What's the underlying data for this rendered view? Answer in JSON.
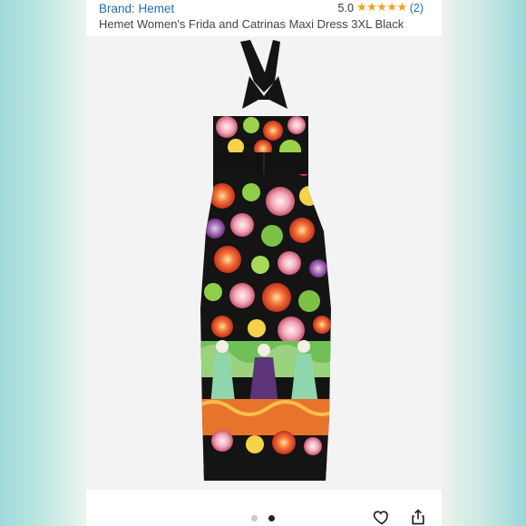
{
  "listing": {
    "brand_label": "Brand: Hemet",
    "rating_value": "5.0",
    "stars": "★★★★★",
    "review_count": "(2)",
    "title": "Hemet Women's Frida and Catrinas Maxi Dress 3XL Black"
  },
  "gallery": {
    "image_alt": "Black floral maxi dress with halter neck and Frida and Catrinas print",
    "pages": 2,
    "active_page": 2
  },
  "icons": {
    "favorite": "heart-outline-icon",
    "share": "share-icon"
  },
  "colors": {
    "link": "#1f6fb2",
    "star": "#f0a11b",
    "dress": "#141414",
    "background_left": "#9fd9da",
    "background_right": "#9bd8d8"
  }
}
